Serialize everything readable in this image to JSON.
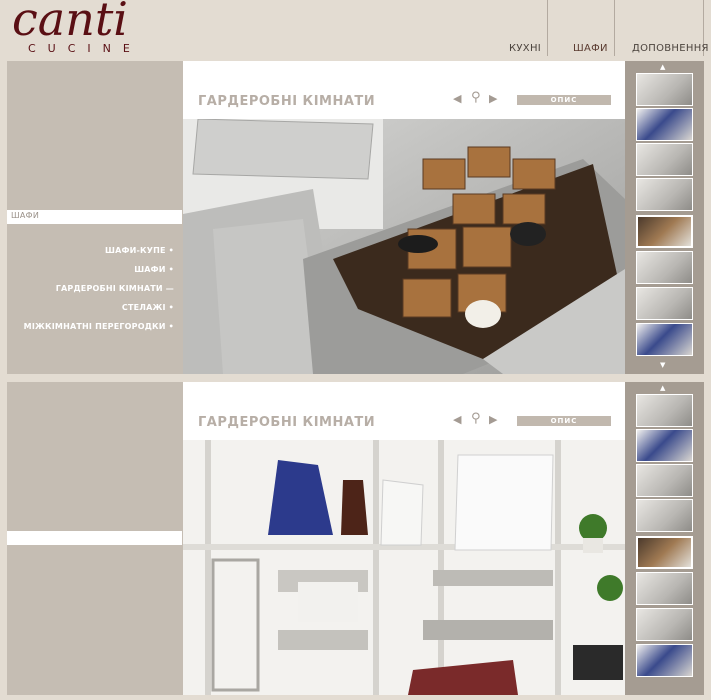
{
  "brand": {
    "name": "canti",
    "sub": "CUCINE",
    "color": "#5a0f14"
  },
  "nav": [
    {
      "label": "КУХНІ",
      "active": false
    },
    {
      "label": "ШАФИ",
      "active": true
    },
    {
      "label": "ДОПОВНЕННЯ",
      "active": false
    }
  ],
  "panel1": {
    "section_label": "ШАФИ",
    "menu": [
      "ШАФИ-КУПЕ •",
      "ШАФИ •",
      "ГАРДЕРОБНІ КІМНАТИ —",
      "СТЕЛАЖІ •",
      "МІЖКІМНАТНІ ПЕРЕГОРОДКИ •"
    ],
    "title": "ГАРДЕРОБНІ КІМНАТИ",
    "opis": "ОПИС"
  },
  "panel2": {
    "title": "ГАРДЕРОБНІ КІМНАТИ",
    "opis": "ОПИС"
  },
  "icons": {
    "prev": "◀",
    "zoom": "⚲",
    "next": "▶",
    "up": "▲",
    "down": "▼"
  }
}
